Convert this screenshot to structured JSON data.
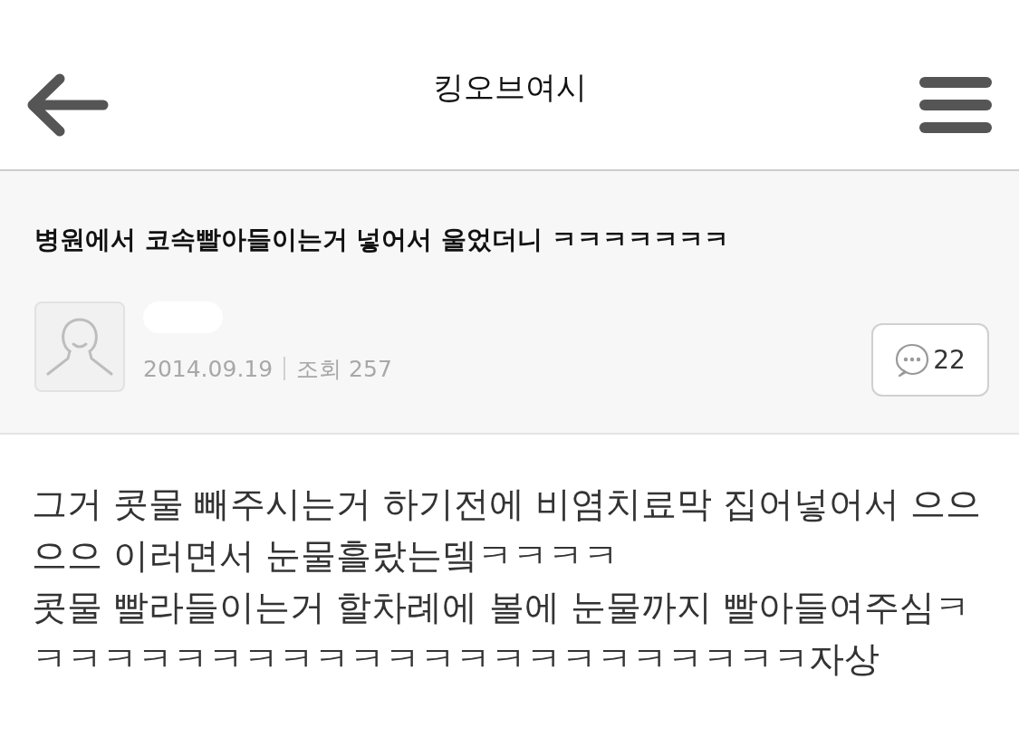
{
  "header": {
    "title": "킹오브여시"
  },
  "post": {
    "title": "병원에서 코속빨아들이는거 넣어서 울었더니 ㅋㅋㅋㅋㅋㅋㅋ",
    "date": "2014.09.19",
    "views": "조회 257",
    "comment_count": "22"
  },
  "body": {
    "paragraphs": [
      "그거 콧물 빼주시는거 하기전에 비염치료막 집어넣어서 으으으으 이러면서 눈물흘랐는뎈ㅋㅋㅋㅋ",
      "콧물 빨라들이는거 할차례에 볼에 눈물까지 빨아들여주심ㅋㅋㅋㅋㅋㅋㅋㅋㅋㅋㅋㅋㅋㅋㅋㅋㅋㅋㅋㅋㅋㅋㅋ자상"
    ]
  }
}
